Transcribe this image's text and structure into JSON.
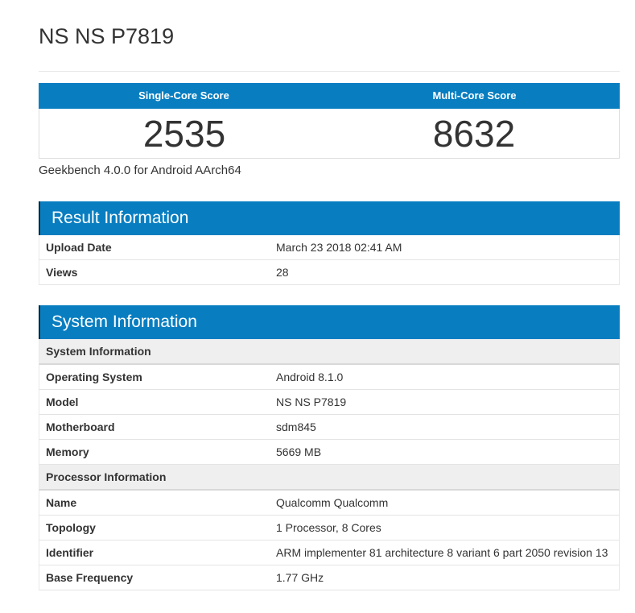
{
  "page": {
    "title": "NS NS P7819"
  },
  "colors": {
    "accent_blue": "#087ec1",
    "header_edge_dark": "#0a2e40",
    "subheader_gray": "#efefef",
    "border_gray": "#e4e4e4",
    "text_dark": "#333333"
  },
  "scoreboard": {
    "columns": [
      {
        "label": "Single-Core Score",
        "score": "2535"
      },
      {
        "label": "Multi-Core Score",
        "score": "8632"
      }
    ],
    "caption": "Geekbench 4.0.0 for Android AArch64"
  },
  "result_information": {
    "heading": "Result Information",
    "rows": [
      {
        "label": "Upload Date",
        "value": "March 23 2018 02:41 AM"
      },
      {
        "label": "Views",
        "value": "28"
      }
    ]
  },
  "system_information": {
    "heading": "System Information",
    "sections": [
      {
        "subheading": "System Information",
        "rows": [
          {
            "label": "Operating System",
            "value": "Android 8.1.0"
          },
          {
            "label": "Model",
            "value": "NS NS P7819"
          },
          {
            "label": "Motherboard",
            "value": "sdm845"
          },
          {
            "label": "Memory",
            "value": "5669 MB"
          }
        ]
      },
      {
        "subheading": "Processor Information",
        "rows": [
          {
            "label": "Name",
            "value": "Qualcomm Qualcomm"
          },
          {
            "label": "Topology",
            "value": "1 Processor, 8 Cores"
          },
          {
            "label": "Identifier",
            "value": "ARM implementer 81 architecture 8 variant 6 part 2050 revision 13"
          },
          {
            "label": "Base Frequency",
            "value": "1.77 GHz"
          }
        ]
      }
    ]
  }
}
